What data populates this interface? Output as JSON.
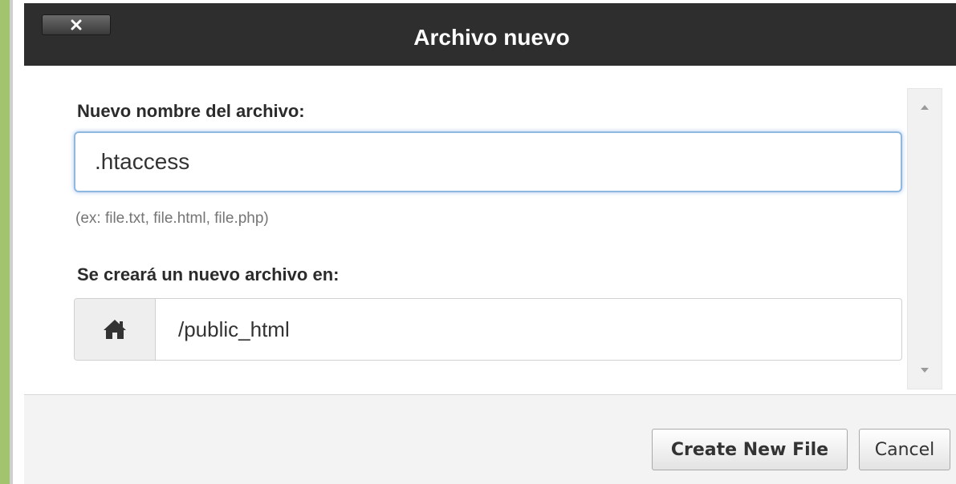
{
  "dialog": {
    "title": "Archivo nuevo",
    "close_label": "×"
  },
  "form": {
    "filename_label": "Nuevo nombre del archivo:",
    "filename_value": ".htaccess",
    "filename_hint": "(ex: file.txt, file.html, file.php)",
    "location_label": "Se creará un nuevo archivo en:",
    "location_icon": "home-icon",
    "location_value": "/public_html"
  },
  "footer": {
    "create_label": "Create New File",
    "cancel_label": "Cancel"
  },
  "colors": {
    "titlebar": "#2e2e2e",
    "page_background": "#a2c46e",
    "input_focus": "#8fb8e0"
  }
}
